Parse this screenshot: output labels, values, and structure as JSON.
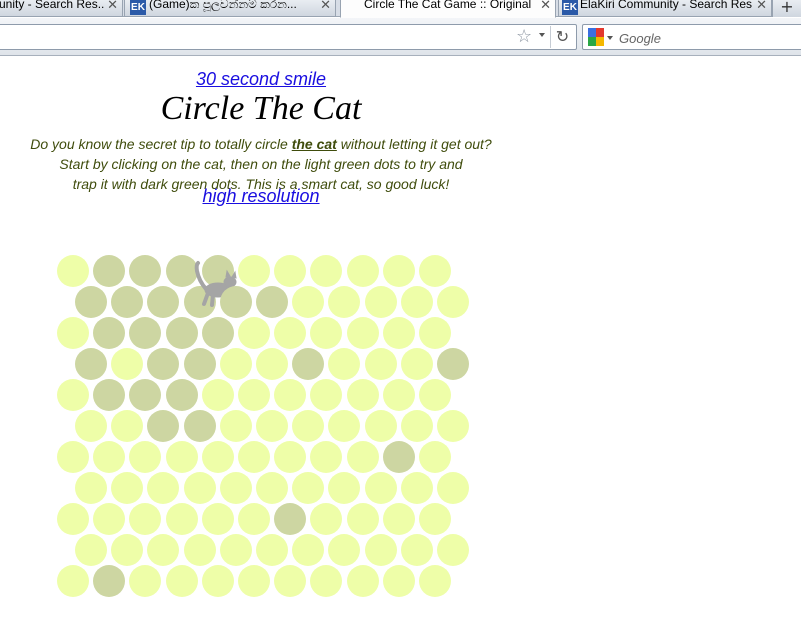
{
  "tabs": [
    {
      "title": "unity - Search Res...",
      "favicon": "",
      "active": false
    },
    {
      "title": "(Game)ක පූලවන්නම් කරන...",
      "favicon": "EK",
      "active": false
    },
    {
      "title": "Circle The Cat Game :: Original",
      "favicon": "",
      "active": true
    },
    {
      "title": "ElaKiri Community - Search Res...",
      "favicon": "EK",
      "active": false
    }
  ],
  "toolbar": {
    "new_tab_label": "+",
    "search_placeholder": "Google"
  },
  "page": {
    "smile_link": "30 second smile",
    "title": "Circle The Cat",
    "intro_line1_before": "Do you know the secret tip to totally circle ",
    "intro_line1_link": "the cat",
    "intro_line1_after": " without letting it get out?",
    "intro_line2": "Start by clicking on the cat, then on the light green dots to try and",
    "intro_line3": "trap it with dark green dots. This is a smart cat, so good luck!",
    "hires_link": "high resolution"
  },
  "board": {
    "colors": {
      "light": "#eefea8",
      "dark": "#cdd6a2",
      "cat": "#a5a5a5"
    },
    "rows": [
      "LDDDDLLLLLL",
      "DDDCDDLLLLL",
      "LDDDDLLLLLL",
      "DLDDLLDLLLD",
      "LDDDLLLLLLL",
      "LLDDLLLLLLL",
      "LLLLLLLLLDL",
      "LLLLLLLLLLL",
      "LLLLLLDLLLL",
      "LLLLLLLLLLL",
      "LDLLLLLLLLL"
    ]
  }
}
